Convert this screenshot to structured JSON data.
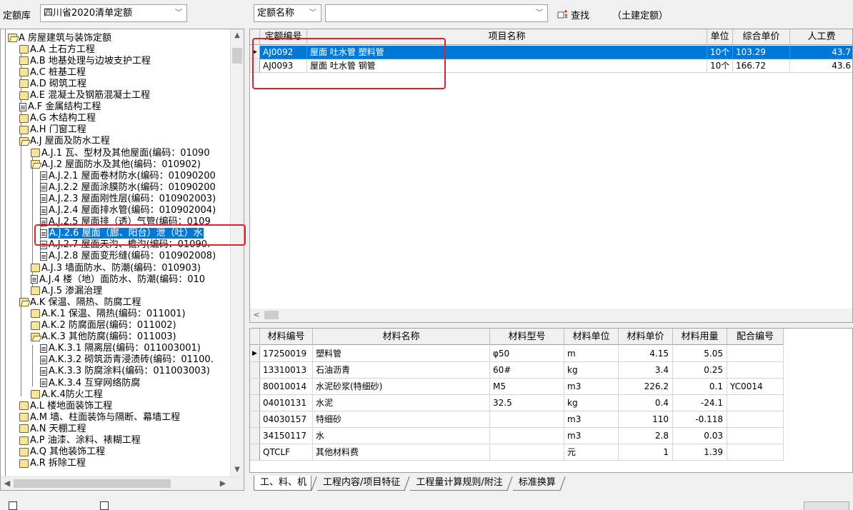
{
  "toolbar": {
    "library_label": "定额库",
    "library_value": "四川省2020清单定额",
    "search_field": "定额名称",
    "search_value": "",
    "find_label": "查找",
    "type_label": "（土建定额）"
  },
  "tree": {
    "nodes": [
      {
        "label": "A 房屋建筑与装饰定额",
        "icon": "folder-open"
      },
      {
        "label": "A.A 土石方工程",
        "icon": "folder"
      },
      {
        "label": "A.B 地基处理与边坡支护工程",
        "icon": "folder"
      },
      {
        "label": "A.C 桩基工程",
        "icon": "folder"
      },
      {
        "label": "A.D 砌筑工程",
        "icon": "folder"
      },
      {
        "label": "A.E 混凝土及钢筋混凝土工程",
        "icon": "folder"
      },
      {
        "label": "A.F 金属结构工程",
        "icon": "document"
      },
      {
        "label": "A.G 木结构工程",
        "icon": "folder"
      },
      {
        "label": "A.H 门窗工程",
        "icon": "folder"
      },
      {
        "label": "A.J 屋面及防水工程",
        "icon": "folder-open"
      },
      {
        "label": "A.J.1 瓦、型材及其他屋面(编码：01090",
        "icon": "folder"
      },
      {
        "label": "A.J.2 屋面防水及其他(编码：010902)",
        "icon": "folder-open"
      },
      {
        "label": "A.J.2.1 屋面卷材防水(编码：01090200",
        "icon": "document"
      },
      {
        "label": "A.J.2.2 屋面涂膜防水(编码：01090200",
        "icon": "document"
      },
      {
        "label": "A.J.2.3 屋面刚性层(编码：010902003)",
        "icon": "document"
      },
      {
        "label": "A.J.2.4 屋面排水管(编码：010902004)",
        "icon": "document"
      },
      {
        "label": "A.J.2.5 屋面排（透）气管(编码：0109",
        "icon": "document"
      },
      {
        "label": "A.J.2.6 屋面（廊、阳台）泄（吐）水",
        "icon": "document"
      },
      {
        "label": "A.J.2.7 屋面天沟、檐沟(编码：01090.",
        "icon": "document"
      },
      {
        "label": "A.J.2.8 屋面变形缝(编码：010902008)",
        "icon": "document"
      },
      {
        "label": "A.J.3 墙面防水、防潮(编码：010903)",
        "icon": "folder"
      },
      {
        "label": "A.J.4 楼（地）面防水、防潮(编码：010",
        "icon": "document"
      },
      {
        "label": "A.J.5 渗漏治理",
        "icon": "folder"
      },
      {
        "label": "A.K 保温、隔热、防腐工程",
        "icon": "folder-open"
      },
      {
        "label": "A.K.1 保温、隔热(编码：011001)",
        "icon": "folder"
      },
      {
        "label": "A.K.2 防腐面层(编码：011002)",
        "icon": "folder"
      },
      {
        "label": "A.K.3 其他防腐(编码：011003)",
        "icon": "folder-open"
      },
      {
        "label": "A.K.3.1 隔离层(编码：011003001)",
        "icon": "document"
      },
      {
        "label": "A.K.3.2 砌筑沥青浸渍砖(编码：01100.",
        "icon": "document"
      },
      {
        "label": "A.K.3.3 防腐涂料(编码：011003003)",
        "icon": "document"
      },
      {
        "label": "A.K.3.4 互穿网络防腐",
        "icon": "document"
      },
      {
        "label": "A.K.4防火工程",
        "icon": "folder"
      },
      {
        "label": "A.L 楼地面装饰工程",
        "icon": "folder"
      },
      {
        "label": "A.M 墙、柱面装饰与隔断、幕墙工程",
        "icon": "folder"
      },
      {
        "label": "A.N 天棚工程",
        "icon": "folder"
      },
      {
        "label": "A.P 油漆、涂料、裱糊工程",
        "icon": "folder"
      },
      {
        "label": "A.Q 其他装饰工程",
        "icon": "folder"
      },
      {
        "label": "A.R 拆除工程",
        "icon": "folder"
      }
    ]
  },
  "quota_grid": {
    "columns": [
      "定额编号",
      "项目名称",
      "单位",
      "综合单价",
      "人工费"
    ],
    "rows": [
      {
        "code": "AJ0092",
        "name": "屋面 吐水管 塑料管",
        "unit": "10个",
        "price": "103.29",
        "labor": "43.7"
      },
      {
        "code": "AJ0093",
        "name": "屋面 吐水管 钢管",
        "unit": "10个",
        "price": "166.72",
        "labor": "43.6"
      }
    ]
  },
  "material_grid": {
    "columns": [
      "材料编号",
      "材料名称",
      "材料型号",
      "材料单位",
      "材料单价",
      "材料用量",
      "配合编号"
    ],
    "rows": [
      {
        "code": "17250019",
        "name": "塑料管",
        "model": "φ50",
        "unit": "m",
        "price": "4.15",
        "qty": "5.05",
        "mix": ""
      },
      {
        "code": "13310013",
        "name": "石油沥青",
        "model": "60#",
        "unit": "kg",
        "price": "3.4",
        "qty": "0.25",
        "mix": ""
      },
      {
        "code": "80010014",
        "name": "水泥砂浆(特细砂)",
        "model": "M5",
        "unit": "m3",
        "price": "226.2",
        "qty": "0.1",
        "mix": "YC0014"
      },
      {
        "code": "04010131",
        "name": "水泥",
        "model": "32.5",
        "unit": "kg",
        "price": "0.4",
        "qty": "-24.1",
        "mix": ""
      },
      {
        "code": "04030157",
        "name": "特细砂",
        "model": "",
        "unit": "m3",
        "price": "110",
        "qty": "-0.118",
        "mix": ""
      },
      {
        "code": "34150117",
        "name": "水",
        "model": "",
        "unit": "m3",
        "price": "2.8",
        "qty": "0.03",
        "mix": ""
      },
      {
        "code": "QTCLF",
        "name": "其他材料费",
        "model": "",
        "unit": "元",
        "price": "1",
        "qty": "1.39",
        "mix": ""
      }
    ]
  },
  "tabs": [
    "工、料、机",
    "工程内容/项目特征",
    "工程量计算规则/附注",
    "标准换算"
  ]
}
